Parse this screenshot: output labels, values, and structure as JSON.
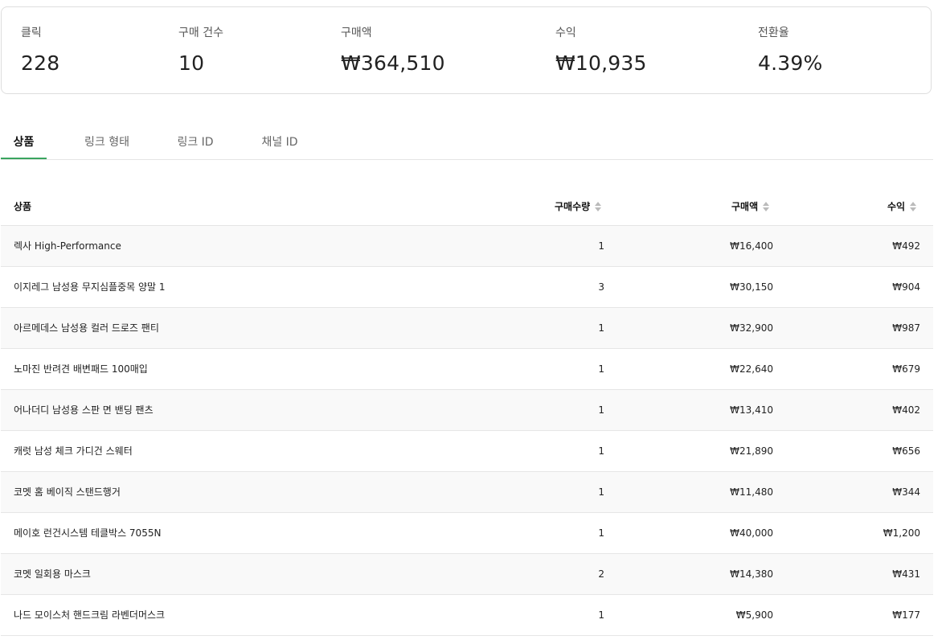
{
  "stats": [
    {
      "label": "클릭",
      "value": "228"
    },
    {
      "label": "구매 건수",
      "value": "10"
    },
    {
      "label": "구매액",
      "value": "₩364,510"
    },
    {
      "label": "수익",
      "value": "₩10,935"
    },
    {
      "label": "전환율",
      "value": "4.39%"
    }
  ],
  "tabs": [
    {
      "label": "상품",
      "active": true
    },
    {
      "label": "링크 형태",
      "active": false
    },
    {
      "label": "링크 ID",
      "active": false
    },
    {
      "label": "채널 ID",
      "active": false
    }
  ],
  "table": {
    "headers": {
      "product": "상품",
      "qty": "구매수량",
      "amount": "구매액",
      "profit": "수익"
    },
    "rows": [
      {
        "product": "렉사 High-Performance",
        "qty": "1",
        "amount": "₩16,400",
        "profit": "₩492"
      },
      {
        "product": "이지레그 남성용 무지심플중목 양말 1",
        "qty": "3",
        "amount": "₩30,150",
        "profit": "₩904"
      },
      {
        "product": "아르메데스 남성용 컬러 드로즈 팬티",
        "qty": "1",
        "amount": "₩32,900",
        "profit": "₩987"
      },
      {
        "product": "노마진 반려견 배변패드 100매입",
        "qty": "1",
        "amount": "₩22,640",
        "profit": "₩679"
      },
      {
        "product": "어나더디 남성용 스판 면 밴딩 팬츠",
        "qty": "1",
        "amount": "₩13,410",
        "profit": "₩402"
      },
      {
        "product": "캐럿 남성 체크 가디건 스웨터",
        "qty": "1",
        "amount": "₩21,890",
        "profit": "₩656"
      },
      {
        "product": "코멧 홈 베이직 스탠드행거",
        "qty": "1",
        "amount": "₩11,480",
        "profit": "₩344"
      },
      {
        "product": "메이호 런건시스템 테클박스 7055N",
        "qty": "1",
        "amount": "₩40,000",
        "profit": "₩1,200"
      },
      {
        "product": "코멧 일회용 마스크",
        "qty": "2",
        "amount": "₩14,380",
        "profit": "₩431"
      },
      {
        "product": "나드 모이스처 핸드크림 라벤더머스크",
        "qty": "1",
        "amount": "₩5,900",
        "profit": "₩177"
      }
    ]
  },
  "colors": {
    "tab_active_underline": "#3aa55f",
    "row_alt_background": "#f9f9f9"
  }
}
